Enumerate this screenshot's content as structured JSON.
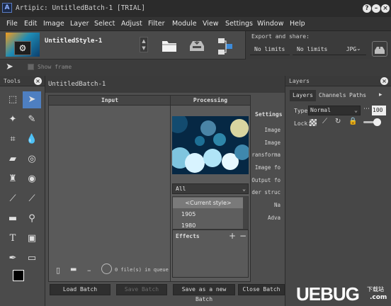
{
  "window": {
    "title": "Artipic: UntitledBatch-1 [TRIAL]",
    "logo_glyph": "A",
    "help_button": "?",
    "minimize_button": "–",
    "close_button": "×"
  },
  "menu": [
    "File",
    "Edit",
    "Image",
    "Layer",
    "Select",
    "Adjust",
    "Filter",
    "Module",
    "View",
    "Settings",
    "Window",
    "Help"
  ],
  "toolbar": {
    "style_name": "UntitledStyle-1",
    "stepper_up": "▲",
    "stepper_down": "▼",
    "export_label": "Export and share:",
    "size1": "No limits",
    "size2": "No limits",
    "format": "JPG"
  },
  "subbar": {
    "show_frame_label": "Show frame"
  },
  "tools_panel": {
    "title": "Tools"
  },
  "batch": {
    "tab_title": "UntitledBatch-1",
    "input_header": "Input",
    "processing_header": "Processing",
    "settings_header": "Settings",
    "settings_items": [
      "Image",
      "Image",
      "ransforma",
      "Image fo",
      "Output fo",
      "der struc",
      "Na",
      "Adva"
    ],
    "filter_select": "All",
    "styles": [
      "<Current style>",
      "1905",
      "1980"
    ],
    "effects_label": "Effects",
    "effects_add": "+",
    "effects_remove": "−",
    "queue_status": "0 file(s) in queue",
    "buttons": {
      "load": "Load Batch",
      "save": "Save Batch",
      "save_new": "Save as a new Batch",
      "close": "Close Batch"
    }
  },
  "layers": {
    "title": "Layers",
    "tabs": [
      "Layers",
      "Channels",
      "Paths"
    ],
    "type_label": "Type:",
    "blend_mode": "Normal",
    "opacity": "100",
    "lock_label": "Lock:"
  },
  "watermark": {
    "main": "UEBUG",
    "sub": "下载站",
    "domain": ".com"
  },
  "colors": {
    "accent": "#4e7fc1",
    "panel": "#4b4b4b",
    "dark": "#2b2b2b"
  }
}
